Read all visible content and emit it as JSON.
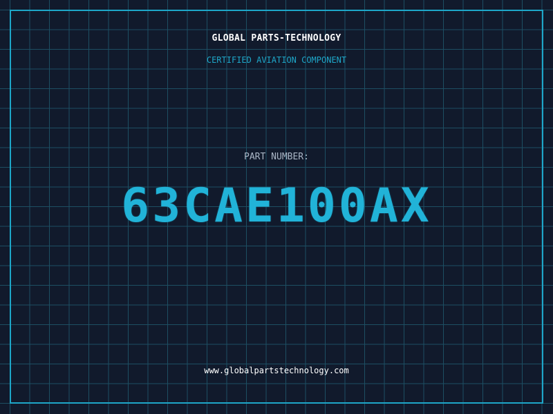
{
  "header": {
    "company": "GLOBAL PARTS-TECHNOLOGY",
    "subtitle": "CERTIFIED AVIATION COMPONENT"
  },
  "main": {
    "label": "PART NUMBER:",
    "part_number": "63CAE100AX"
  },
  "footer": {
    "website": "www.globalpartstechnology.com"
  },
  "colors": {
    "background": "#111a2c",
    "grid": "#1d4f63",
    "accent": "#1ea7c9",
    "text": "#ffffff",
    "label": "#aab6c6"
  }
}
